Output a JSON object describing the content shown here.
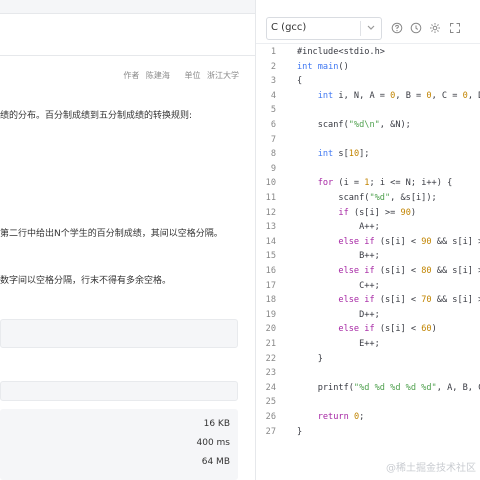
{
  "problem": {
    "meta": {
      "author_label": "作者",
      "author": "陈建海",
      "unit_label": "单位",
      "unit": "浙江大学"
    },
    "desc_line1": "绩的分布。百分制成绩到五分制成绩的转换规则:",
    "desc_line2": "第二行中给出N个学生的百分制成绩，其间以空格分隔。",
    "desc_line3": "数字间以空格分隔，行末不得有多余空格。",
    "limits": [
      "16 KB",
      "400 ms",
      "64 MB"
    ]
  },
  "editor": {
    "language": "C (gcc)",
    "toolbar_icons": [
      "help-icon",
      "history-icon",
      "settings-icon",
      "fullscreen-icon"
    ],
    "lines": [
      "#include<stdio.h>",
      "int main()",
      "{",
      "    int i, N, A = 0, B = 0, C = 0, D",
      "",
      "    scanf(\"%d\\n\", &N);",
      "",
      "    int s[10];",
      "",
      "    for (i = 1; i <= N; i++) {",
      "        scanf(\"%d\", &s[i]);",
      "        if (s[i] >= 90)",
      "            A++;",
      "        else if (s[i] < 90 && s[i] >=",
      "            B++;",
      "        else if (s[i] < 80 && s[i] >=",
      "            C++;",
      "        else if (s[i] < 70 && s[i] >=",
      "            D++;",
      "        else if (s[i] < 60)",
      "            E++;",
      "    }",
      "",
      "    printf(\"%d %d %d %d %d\", A, B, C,",
      "",
      "    return 0;",
      "}"
    ]
  },
  "watermark": "@稀土掘金技术社区"
}
